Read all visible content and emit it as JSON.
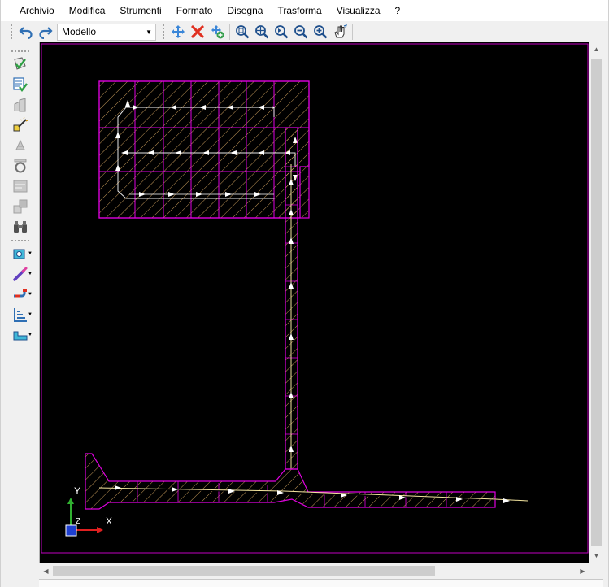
{
  "menu": {
    "items": [
      "Archivio",
      "Modifica",
      "Strumenti",
      "Formato",
      "Disegna",
      "Trasforma",
      "Visualizza",
      "?"
    ]
  },
  "toolbar": {
    "undo_icon": "undo-icon",
    "redo_icon": "redo-icon",
    "space_combo_value": "Modello",
    "tools": [
      "move-icon",
      "delete-icon",
      "add-copy-icon",
      "zoom-window-icon",
      "zoom-center-icon",
      "zoom-previous-icon",
      "zoom-out-icon",
      "zoom-in-icon",
      "pan-hand-icon"
    ]
  },
  "palette": {
    "tools": [
      "select-check-icon",
      "properties-check-icon",
      "building-icon",
      "wand-icon",
      "elements-icon",
      "ring-icon",
      "component-icon",
      "blocks-icon",
      "binoculars-icon",
      "camera-icon",
      "brush-icon",
      "pipe-icon",
      "level-icon",
      "tub-icon"
    ]
  },
  "canvas": {
    "background": "#000000",
    "hatch_color": "#e000e0",
    "path_color": "#f5e6a0",
    "arrow_color": "#ffffff",
    "ucs": {
      "y_label": "Y",
      "x_label": "X",
      "z_label": "Z"
    }
  },
  "colors": {
    "undo_blue": "#2f6fb4",
    "delete_red": "#e03020",
    "zoom_blue": "#1e4f8c"
  }
}
